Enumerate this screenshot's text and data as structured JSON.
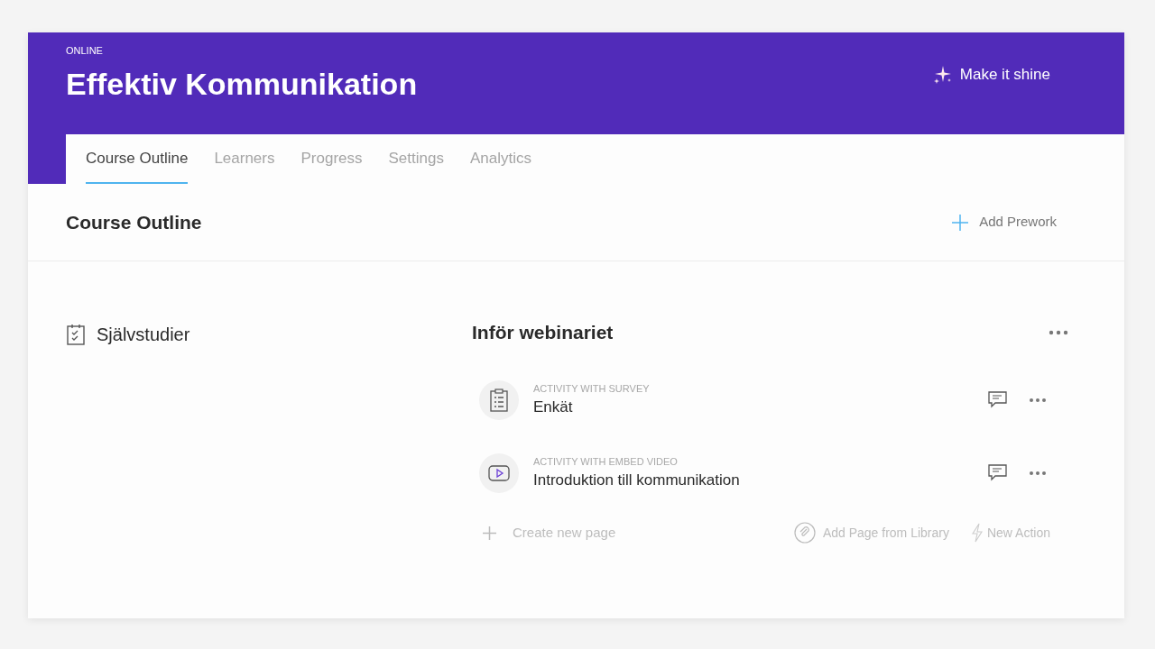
{
  "header": {
    "label": "ONLINE",
    "title": "Effektiv Kommunikation",
    "action": "Make it shine"
  },
  "tabs": [
    {
      "label": "Course Outline",
      "selected": true
    },
    {
      "label": "Learners",
      "selected": false
    },
    {
      "label": "Progress",
      "selected": false
    },
    {
      "label": "Settings",
      "selected": false
    },
    {
      "label": "Analytics",
      "selected": false
    }
  ],
  "section": {
    "title": "Course Outline",
    "action": "Add Prework"
  },
  "module": {
    "title": "Självstudier"
  },
  "group": {
    "title": "Inför webinariet",
    "activities": [
      {
        "kind": "survey",
        "type_label": "ACTIVITY WITH SURVEY",
        "title": "Enkät"
      },
      {
        "kind": "video",
        "type_label": "ACTIVITY WITH EMBED VIDEO",
        "title": "Introduktion till kommunikation"
      }
    ],
    "footer": {
      "create": "Create new page",
      "library": "Add Page from Library",
      "new_action": "New Action"
    }
  }
}
